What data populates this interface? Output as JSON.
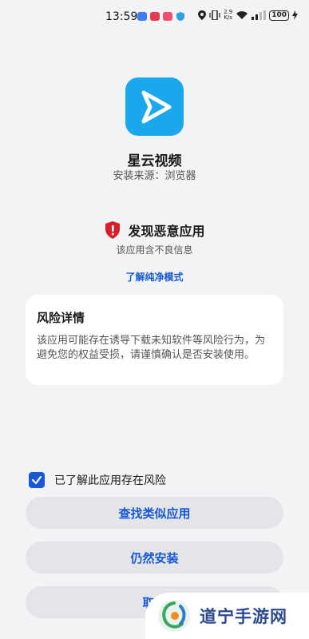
{
  "status_bar": {
    "time": "13:59",
    "speed_value": "2.9",
    "speed_unit": "K/s",
    "battery": "100",
    "notification_colors": [
      "#3d7cf2",
      "#e8384f",
      "#f0506e"
    ]
  },
  "app": {
    "name": "星云视频",
    "source": "安装来源：浏览器",
    "icon": "play-arrow-icon",
    "icon_color": "#1aa7ec"
  },
  "warning": {
    "title": "发现恶意应用",
    "subtitle": "该应用含不良信息",
    "learn_link": "了解纯净模式",
    "shield_color": "#d81e2a"
  },
  "risk": {
    "title": "风险详情",
    "body": "该应用可能存在诱导下载未知软件等风险行为，为避免您的权益受损，请谨慎确认是否安装使用。"
  },
  "acknowledge": {
    "label": "已了解此应用存在风险",
    "checked": true
  },
  "buttons": {
    "find_similar": "查找类似应用",
    "install_anyway": "仍然安装",
    "cancel": "取消"
  },
  "watermark": {
    "text": "道宁手游网"
  },
  "colors": {
    "accent": "#1858d6",
    "background": "#f1f3f5"
  }
}
